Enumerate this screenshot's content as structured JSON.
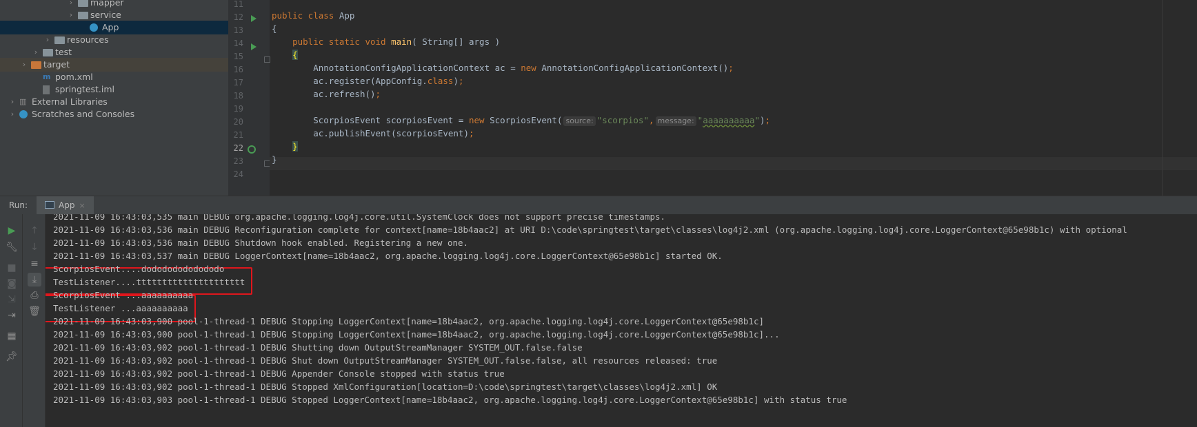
{
  "project_tree": [
    {
      "label": "mapper",
      "kind": "folder",
      "indent": 5,
      "chevron": "›"
    },
    {
      "label": "service",
      "kind": "folder",
      "indent": 5,
      "chevron": "›"
    },
    {
      "label": "App",
      "kind": "class",
      "indent": 6,
      "chevron": "",
      "selected": true
    },
    {
      "label": "resources",
      "kind": "res-folder",
      "indent": 3,
      "chevron": "›"
    },
    {
      "label": "test",
      "kind": "folder",
      "indent": 2,
      "chevron": "›"
    },
    {
      "label": "target",
      "kind": "orange-folder",
      "indent": 1,
      "chevron": "›",
      "highlight": true
    },
    {
      "label": "pom.xml",
      "kind": "maven",
      "indent": 2,
      "chevron": ""
    },
    {
      "label": "springtest.iml",
      "kind": "file",
      "indent": 2,
      "chevron": ""
    },
    {
      "label": "External Libraries",
      "kind": "lib",
      "indent": 0,
      "chevron": "›"
    },
    {
      "label": "Scratches and Consoles",
      "kind": "scratch",
      "indent": 0,
      "chevron": "›"
    }
  ],
  "editor": {
    "line_numbers": [
      "11",
      "12",
      "13",
      "14",
      "15",
      "16",
      "17",
      "18",
      "19",
      "20",
      "21",
      "22",
      "23",
      "24"
    ],
    "current_line": "22",
    "code": {
      "l12_kw": "public class",
      "l12_name": " App",
      "l13": "{",
      "l14_kw1": "public static void",
      "l14_fn": "main",
      "l14_rest": "( String[] args )",
      "l15": "{",
      "l16_a": "AnnotationConfigApplicationContext ac = ",
      "l16_kw": "new",
      "l16_b": " AnnotationConfigApplicationContext()",
      "l16_semi": ";",
      "l17_a": "ac.register(AppConfig.",
      "l17_kw": "class",
      "l17_b": ")",
      "l17_semi": ";",
      "l18_a": "ac.refresh()",
      "l18_semi": ";",
      "l20_a": "ScorpiosEvent scorpiosEvent = ",
      "l20_kw": "new",
      "l20_b": " ScorpiosEvent(",
      "l20_hint1": "source:",
      "l20_str1": "\"scorpios\"",
      "l20_comma": ",",
      "l20_hint2": "message:",
      "l20_q1": "\"",
      "l20_str2": "aaaaaaaaaa",
      "l20_q2": "\"",
      "l20_c": ")",
      "l20_semi": ";",
      "l21_a": "ac.publishEvent(scorpiosEvent)",
      "l21_semi": ";",
      "l22": "}",
      "l23": "}"
    }
  },
  "run_panel": {
    "label": "Run:",
    "tab_label": "App",
    "tab_close": "×"
  },
  "console_lines": [
    "2021-11-09 16:43:03,535 main DEBUG org.apache.logging.log4j.core.util.SystemClock does not support precise timestamps.",
    "2021-11-09 16:43:03,536 main DEBUG Reconfiguration complete for context[name=18b4aac2] at URI D:\\code\\springtest\\target\\classes\\log4j2.xml (org.apache.logging.log4j.core.LoggerContext@65e98b1c) with optional",
    "2021-11-09 16:43:03,536 main DEBUG Shutdown hook enabled. Registering a new one.",
    "2021-11-09 16:43:03,537 main DEBUG LoggerContext[name=18b4aac2, org.apache.logging.log4j.core.LoggerContext@65e98b1c] started OK.",
    "ScorpiosEvent....dodododododododo",
    "TestListener....ttttttttttttttttttttt",
    "ScorpiosEvent ...aaaaaaaaaa",
    "TestListener ...aaaaaaaaaa",
    "2021-11-09 16:43:03,900 pool-1-thread-1 DEBUG Stopping LoggerContext[name=18b4aac2, org.apache.logging.log4j.core.LoggerContext@65e98b1c]",
    "2021-11-09 16:43:03,900 pool-1-thread-1 DEBUG Stopping LoggerContext[name=18b4aac2, org.apache.logging.log4j.core.LoggerContext@65e98b1c]...",
    "2021-11-09 16:43:03,902 pool-1-thread-1 DEBUG Shutting down OutputStreamManager SYSTEM_OUT.false.false",
    "2021-11-09 16:43:03,902 pool-1-thread-1 DEBUG Shut down OutputStreamManager SYSTEM_OUT.false.false, all resources released: true",
    "2021-11-09 16:43:03,902 pool-1-thread-1 DEBUG Appender Console stopped with status true",
    "2021-11-09 16:43:03,902 pool-1-thread-1 DEBUG Stopped XmlConfiguration[location=D:\\code\\springtest\\target\\classes\\log4j2.xml] OK",
    "2021-11-09 16:43:03,903 pool-1-thread-1 DEBUG Stopped LoggerContext[name=18b4aac2, org.apache.logging.log4j.core.LoggerContext@65e98b1c] with status true"
  ],
  "toolbar_left": [
    "run-icon",
    "wrench-icon",
    "stop-icon",
    "camera-icon",
    "exit-icon",
    "login-icon",
    "layout-icon",
    "pin-icon"
  ],
  "toolbar_right": [
    "up-arrow-icon",
    "down-arrow-icon",
    "soft-wrap-icon",
    "scroll-to-end-icon",
    "print-icon",
    "trash-icon"
  ],
  "colors": {
    "highlight_box": "#e0161c",
    "keyword": "#cc7832",
    "function": "#ffc66d",
    "string": "#6a8759",
    "selection": "#0d293e"
  }
}
